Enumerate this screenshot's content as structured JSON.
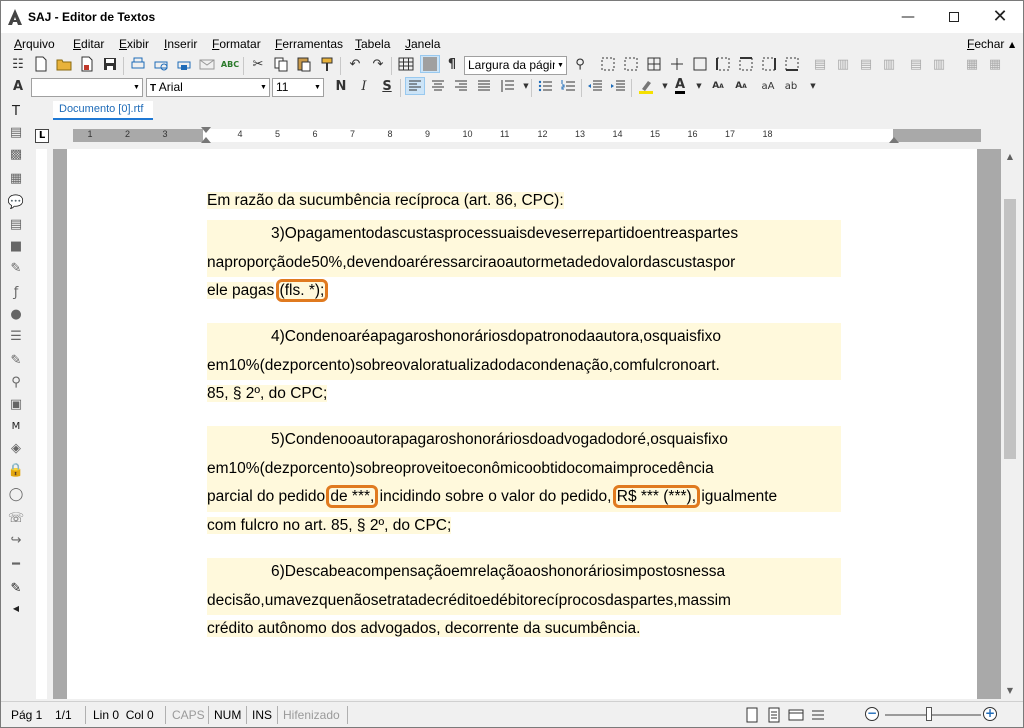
{
  "window": {
    "title": "SAJ - Editor de Textos"
  },
  "menu": {
    "items": [
      "Arquivo",
      "Editar",
      "Exibir",
      "Inserir",
      "Formatar",
      "Ferramentas",
      "Tabela",
      "Janela"
    ],
    "close_label": "Fechar"
  },
  "toolbar": {
    "zoom_value": "Largura da págin",
    "style_value": "",
    "font_value": "Arial",
    "size_value": "11",
    "bold_glyph": "N",
    "italic_glyph": "I",
    "strike_glyph": "S",
    "pilcrow_glyph": "¶"
  },
  "document": {
    "tab_label": "Documento [0].rtf",
    "paragraphs": {
      "p1": "Em razão da sucumbência recíproca (art. 86, CPC):",
      "p2_l1": "3) O pagamento das custas processuais deve ser repartido entre as partes",
      "p2_l2": "na proporção de 50%, devendo a ré ressarcir ao autor metade do valor das custas por",
      "p2_l3a": "ele pagas",
      "p2_l3b": "(fls. *);",
      "p3_l1": "4) Condeno a ré a pagar os honorários do patrono da autora, os quais fixo",
      "p3_l2": "em 10% (dez por cento) sobre o valor atualizado da condenação, com fulcro no art.",
      "p3_l3": "85, § 2º, do CPC;",
      "p4_l1": "5) Condeno o autor a pagar os honorários do advogado do ré, os quais fixo",
      "p4_l2": "em 10% (dez por cento) sobre o proveito econômico obtido com a improcedência",
      "p4_l3a": "parcial do pedido",
      "p4_l3b": "de ***,",
      "p4_l3c": "incidindo sobre o valor do pedido,",
      "p4_l3d": "R$ *** (***),",
      "p4_l3e": "igualmente",
      "p4_l4": "com fulcro no art. 85, § 2º, do CPC;",
      "p5_l1": "6) Descabe a compensação em relação aos honorários impostos nessa",
      "p5_l2": "decisão, uma vez que não se trata de crédito e débito recíprocos das partes, mas sim",
      "p5_l3": "crédito autônomo dos advogados, decorrente da sucumbência."
    }
  },
  "ruler": {
    "numbers": [
      "1",
      "2",
      "3",
      "4",
      "5",
      "6",
      "7",
      "8",
      "9",
      "10",
      "11",
      "12",
      "13",
      "14",
      "15",
      "16",
      "17",
      "18"
    ],
    "corner": "L"
  },
  "status": {
    "page": "Pág 1",
    "pages": "1/1",
    "position": "Lin 0  Col 0",
    "caps": "CAPS",
    "num": "NUM",
    "ins": "INS",
    "hyphen": "Hifenizado"
  },
  "colors": {
    "highlight": "#fff9dc",
    "marker_box": "#e07a1f",
    "tab_accent": "#1e78d4"
  }
}
